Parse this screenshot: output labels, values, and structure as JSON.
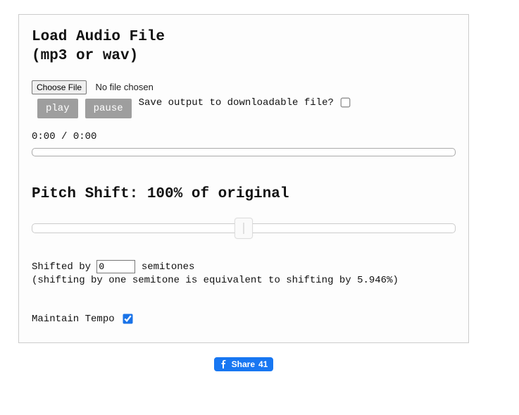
{
  "load": {
    "heading_line1": "Load Audio File",
    "heading_line2": "(mp3 or wav)",
    "choose_file_label": "Choose File",
    "file_status": "No file chosen",
    "play_label": "play",
    "pause_label": "pause",
    "save_output_label": "Save output to downloadable file?",
    "save_output_checked": false,
    "time_current": "0:00",
    "time_separator": " / ",
    "time_total": "0:00"
  },
  "pitch": {
    "heading": "Pitch Shift: 100% of original",
    "slider_value_percent": 100,
    "shifted_by_prefix": "Shifted by ",
    "semitones_value": "0",
    "shifted_by_suffix": " semitones",
    "note": "(shifting by one semitone is equivalent to shifting by 5.946%)",
    "maintain_tempo_label": "Maintain Tempo",
    "maintain_tempo_checked": true
  },
  "share": {
    "label": "Share",
    "count": "41"
  }
}
